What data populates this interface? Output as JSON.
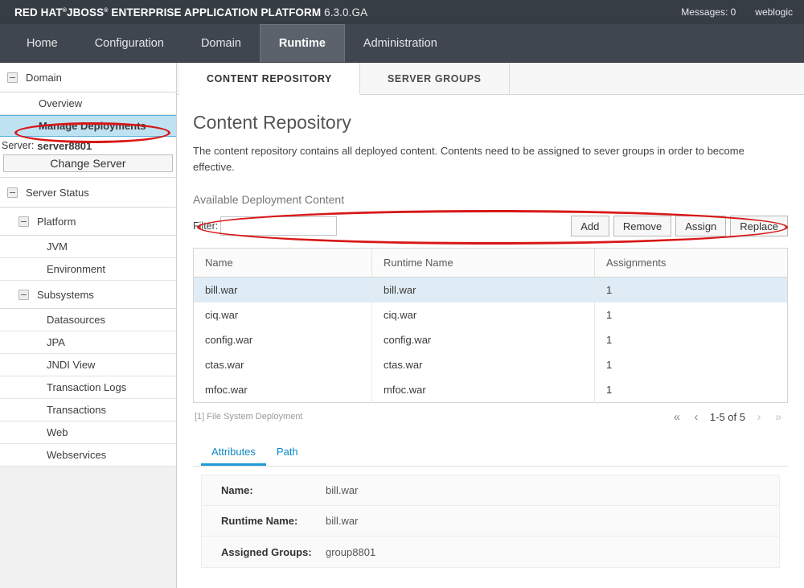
{
  "header": {
    "brand_bold_1": "RED HAT",
    "brand_tm_1": "®",
    "brand_bold_2": "JBOSS",
    "brand_tm_2": "®",
    "brand_bold_3": "ENTERPRISE APPLICATION PLATFORM",
    "version": "6.3.0.GA",
    "messages": "Messages: 0",
    "user": "weblogic"
  },
  "nav": {
    "items": [
      {
        "label": "Home",
        "active": false
      },
      {
        "label": "Configuration",
        "active": false
      },
      {
        "label": "Domain",
        "active": false
      },
      {
        "label": "Runtime",
        "active": true
      },
      {
        "label": "Administration",
        "active": false
      }
    ]
  },
  "sidebar": {
    "domain_section": "Domain",
    "domain_links": [
      {
        "label": "Overview",
        "selected": false
      },
      {
        "label": "Manage Deployments",
        "selected": true
      }
    ],
    "server_label": "Server:",
    "server_name": "server8801",
    "change_server_button": "Change Server",
    "server_status_section": "Server Status",
    "platform_group": "Platform",
    "platform_links": [
      {
        "label": "JVM"
      },
      {
        "label": "Environment"
      }
    ],
    "subsystems_group": "Subsystems",
    "subsystem_links": [
      {
        "label": "Datasources"
      },
      {
        "label": "JPA"
      },
      {
        "label": "JNDI View"
      },
      {
        "label": "Transaction Logs"
      },
      {
        "label": "Transactions"
      },
      {
        "label": "Web"
      },
      {
        "label": "Webservices"
      }
    ]
  },
  "content_tabs": [
    {
      "label": "CONTENT REPOSITORY",
      "active": true
    },
    {
      "label": "SERVER GROUPS",
      "active": false
    }
  ],
  "main": {
    "title": "Content Repository",
    "description": "The content repository contains all deployed content. Contents need to be assigned to sever groups in order to become effective.",
    "section_label": "Available Deployment Content",
    "filter_label": "Filter:",
    "filter_value": "",
    "filter_placeholder": "",
    "buttons": [
      {
        "label": "Add"
      },
      {
        "label": "Remove"
      },
      {
        "label": "Assign"
      },
      {
        "label": "Replace"
      }
    ],
    "table": {
      "columns": [
        "Name",
        "Runtime Name",
        "Assignments"
      ],
      "rows": [
        {
          "name": "bill.war",
          "runtime_name": "bill.war",
          "assignments": "1",
          "selected": true
        },
        {
          "name": "ciq.war",
          "runtime_name": "ciq.war",
          "assignments": "1",
          "selected": false
        },
        {
          "name": "config.war",
          "runtime_name": "config.war",
          "assignments": "1",
          "selected": false
        },
        {
          "name": "ctas.war",
          "runtime_name": "ctas.war",
          "assignments": "1",
          "selected": false
        },
        {
          "name": "mfoc.war",
          "runtime_name": "mfoc.war",
          "assignments": "1",
          "selected": false
        }
      ],
      "footnote": "[1] File System Deployment",
      "pager": {
        "first": "«",
        "prev": "‹",
        "range": "1-5 of 5",
        "next": "›",
        "last": "»"
      }
    },
    "detail_tabs": [
      {
        "label": "Attributes",
        "active": true
      },
      {
        "label": "Path",
        "active": false
      }
    ],
    "attributes": [
      {
        "label": "Name:",
        "value": "bill.war"
      },
      {
        "label": "Runtime Name:",
        "value": "bill.war"
      },
      {
        "label": "Assigned Groups:",
        "value": "group8801"
      }
    ]
  },
  "annotations": {
    "color": "#d81717",
    "shapes": [
      {
        "name": "manage-deployments-highlight"
      },
      {
        "name": "toolbar-highlight"
      }
    ]
  }
}
